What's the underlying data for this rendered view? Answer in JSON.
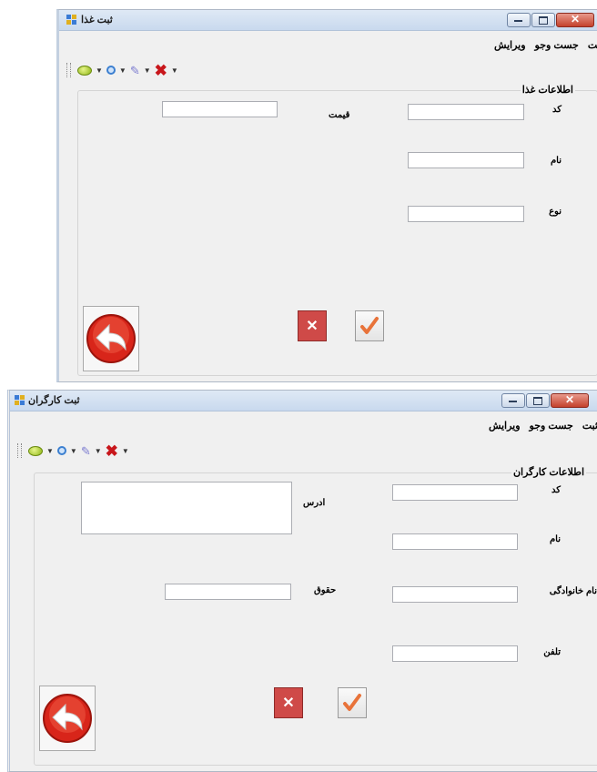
{
  "food_form": {
    "title": "ثبت غذا",
    "menu": [
      "ثبت",
      "جست وجو",
      "ویرایش"
    ],
    "group_title": "اطلاعات غذا",
    "labels": {
      "code": "کد",
      "name": "نام",
      "type": "نوع",
      "price": "قیمت"
    },
    "fields": {
      "code": "",
      "name": "",
      "type": "",
      "price": ""
    }
  },
  "worker_form": {
    "title": "ثبت کارگران",
    "menu": [
      "ثبت",
      "جست وجو",
      "ویرایش"
    ],
    "group_title": "اطلاعات کارگران",
    "labels": {
      "code": "کد",
      "name": "نام",
      "family": "نام خانوادگی",
      "phone": "تلفن",
      "address": "ادرس",
      "salary": "حقوق"
    },
    "fields": {
      "code": "",
      "name": "",
      "family": "",
      "phone": "",
      "address": "",
      "salary": ""
    }
  },
  "toolbar_icons": [
    "green-oval-icon",
    "circle-icon",
    "pen-icon",
    "red-x-icon"
  ],
  "window_controls": [
    "minimize-icon",
    "maximize-icon",
    "close-icon"
  ],
  "colors": {
    "close_button": "#c4412c",
    "cancel_button": "#cf4a48",
    "check_mark": "#e8733a",
    "back_button": "#d8251a"
  }
}
